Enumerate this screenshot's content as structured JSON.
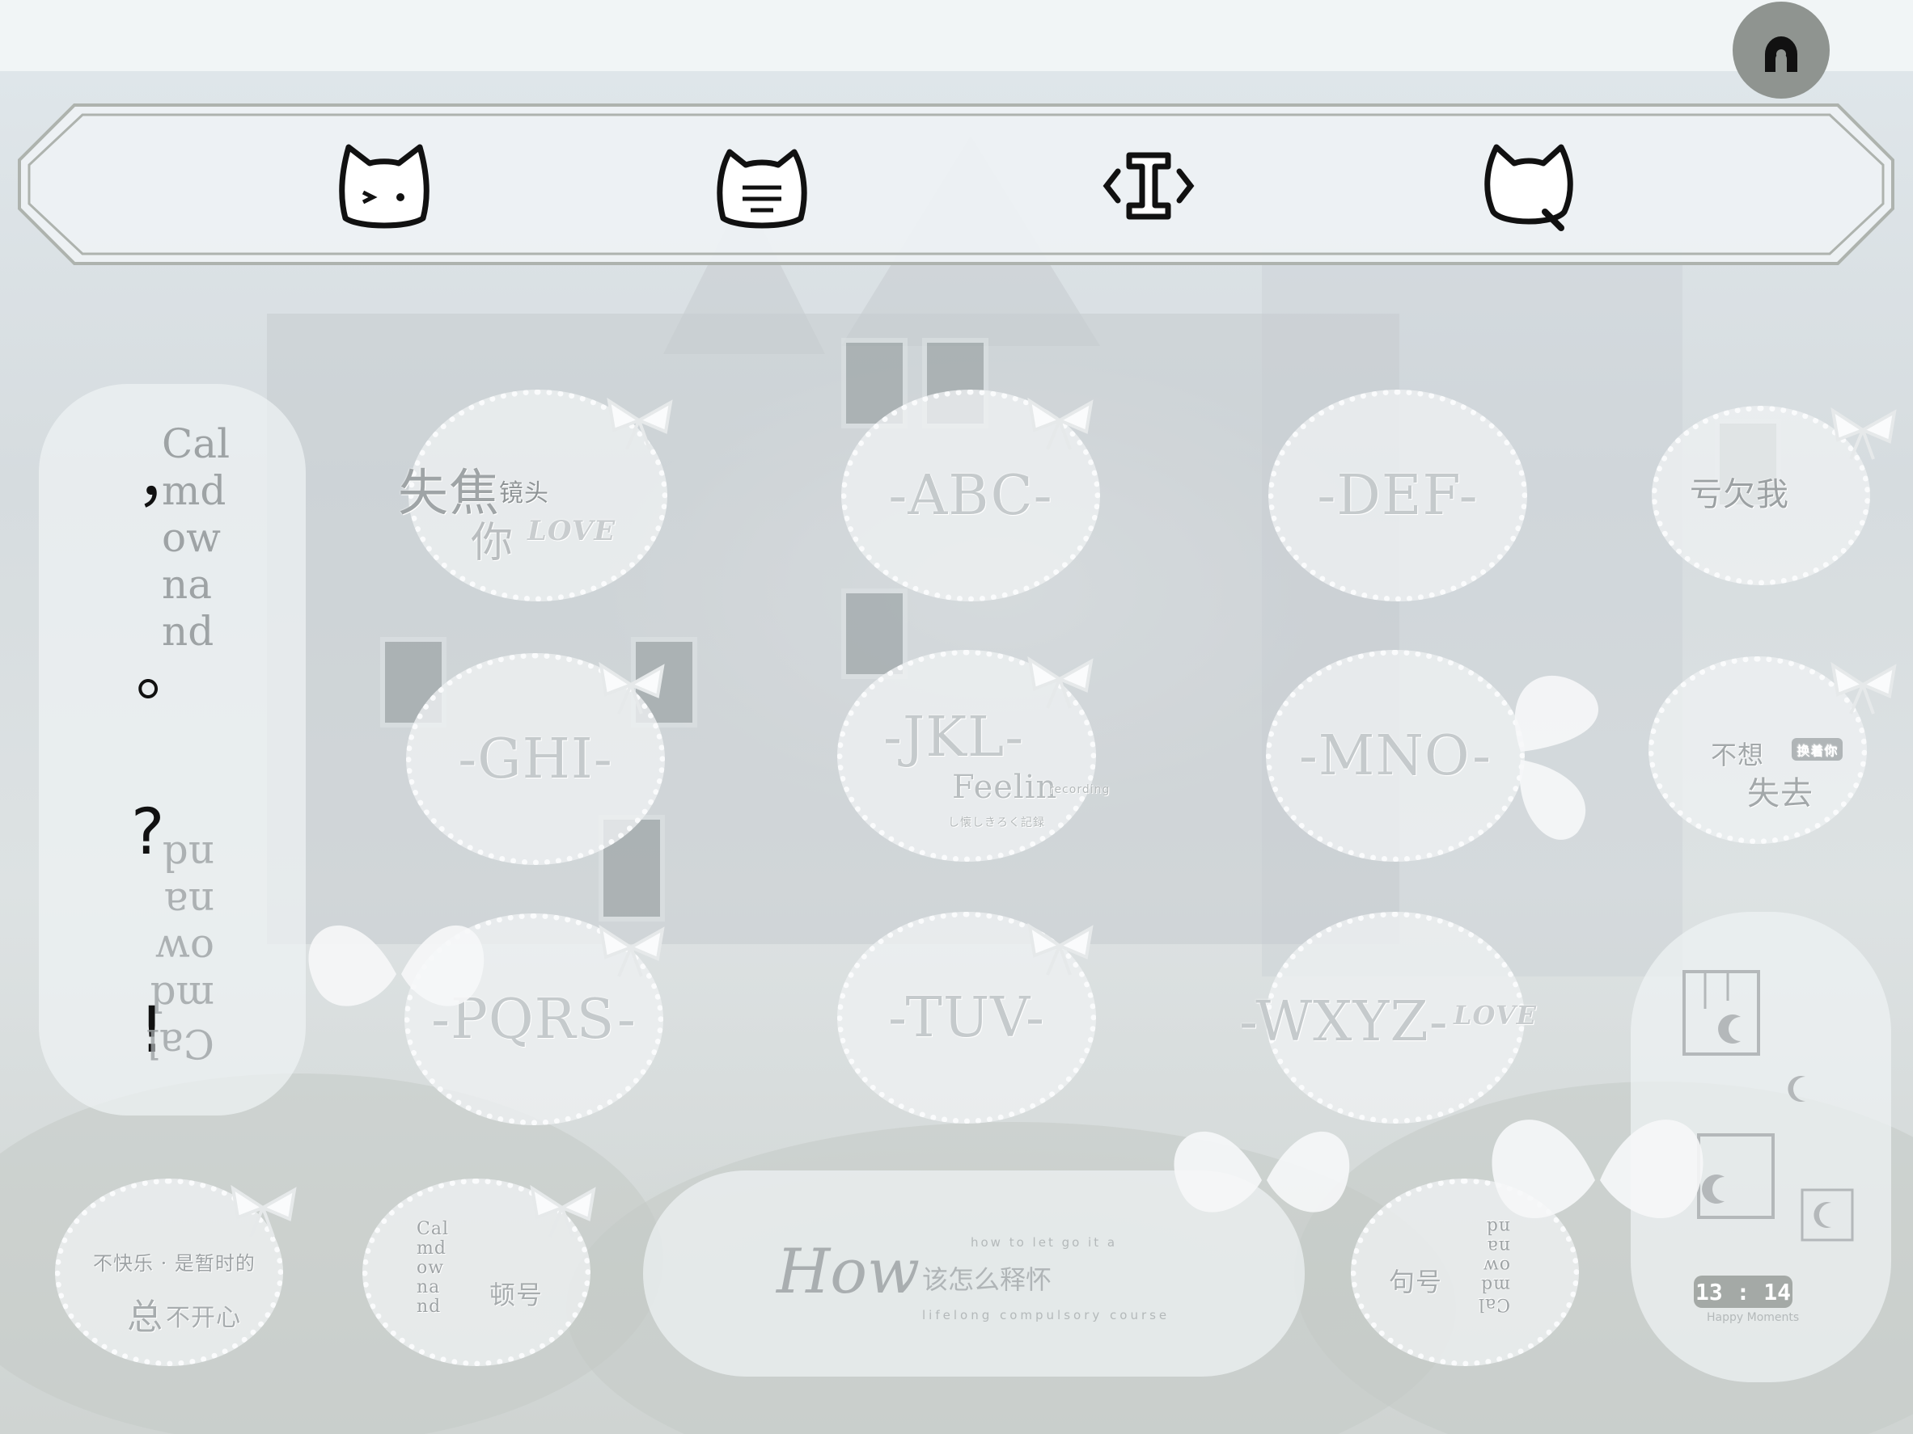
{
  "toolbar": {
    "items": [
      {
        "name": "cat-wink-icon"
      },
      {
        "name": "cat-keyboard-icon"
      },
      {
        "name": "cursor-move-icon"
      },
      {
        "name": "cat-search-icon"
      }
    ]
  },
  "account": {
    "icon": "user-icon"
  },
  "keys": {
    "row1": [
      "-ABC-",
      "-DEF-"
    ],
    "row2": [
      "-GHI-",
      "-JKL-",
      "-MNO-"
    ],
    "row3": [
      "-PQRS-",
      "-TUV-",
      "-WXYZ-"
    ]
  },
  "stickers": {
    "k1_main": "失焦",
    "k1_small": "镜头",
    "k1_second": "你",
    "love": "LOVE",
    "k4_text": "亏欠我",
    "jkl_sub": "Feelin",
    "jkl_tag": "recording",
    "jkl_jp": "し懐しきろく記録",
    "k8_a": "不想",
    "k8_badge": "换着你",
    "k8_b": "失去",
    "b1_a": "不快乐 · 是暂时的",
    "b1_b": "总",
    "b1_c": "不开心",
    "b2_text": "顿号",
    "space_script": "How",
    "space_cn": "该怎么释怀",
    "space_en_top": "how to let go it a",
    "space_en_bottom": "lifelong compulsory course",
    "b4_text": "句号",
    "clock_time": "13 : 14",
    "clock_caption": "Happy Moments"
  },
  "left_panel": {
    "calm_text": "Calmdownand",
    "comma": "，",
    "period": "。",
    "question": "?",
    "exclaim": "!"
  }
}
